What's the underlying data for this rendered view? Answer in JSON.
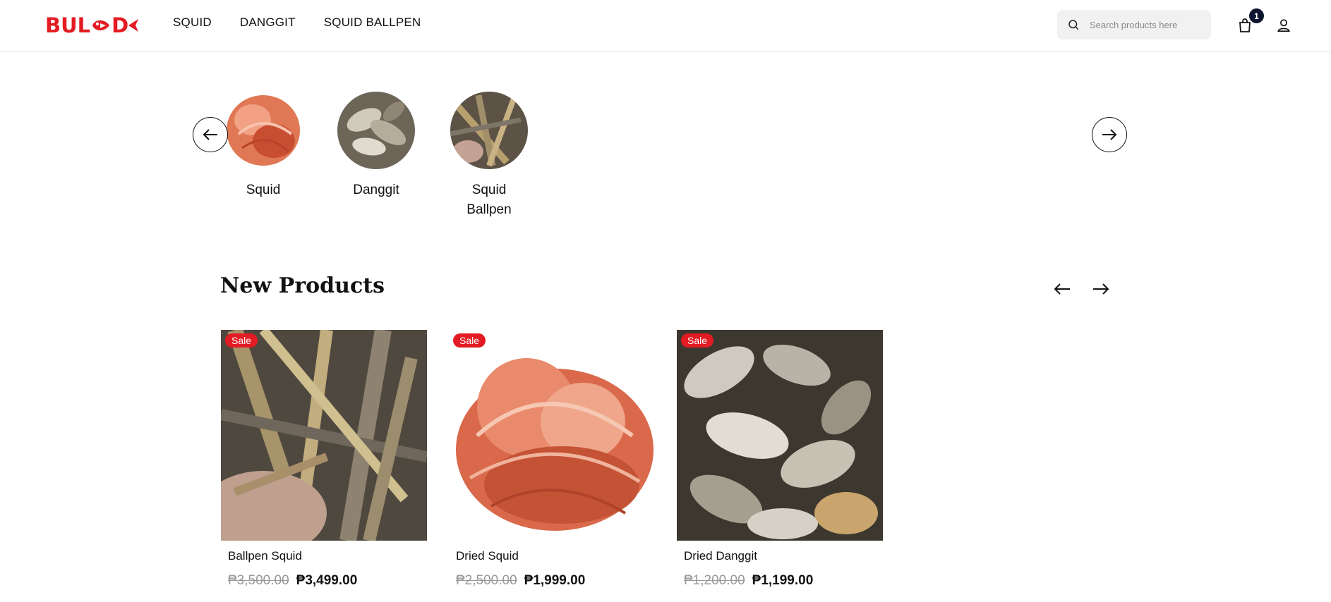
{
  "brand": {
    "logo_text": "BUL",
    "logo_end": "D",
    "accent": "#e31b23"
  },
  "nav": {
    "items": [
      "SQUID",
      "DANGGIT",
      "SQUID BALLPEN"
    ]
  },
  "search": {
    "placeholder": "Search products here"
  },
  "cart": {
    "count": "1"
  },
  "categories": [
    {
      "label": "Squid"
    },
    {
      "label": "Danggit"
    },
    {
      "label": "Squid Ballpen"
    }
  ],
  "new_products": {
    "title": "New Products",
    "items": [
      {
        "badge": "Sale",
        "name": "Ballpen Squid",
        "old_price": "₱3,500.00",
        "price": "₱3,499.00"
      },
      {
        "badge": "Sale",
        "name": "Dried Squid",
        "old_price": "₱2,500.00",
        "price": "₱1,999.00"
      },
      {
        "badge": "Sale",
        "name": "Dried Danggit",
        "old_price": "₱1,200.00",
        "price": "₱1,199.00"
      }
    ]
  }
}
